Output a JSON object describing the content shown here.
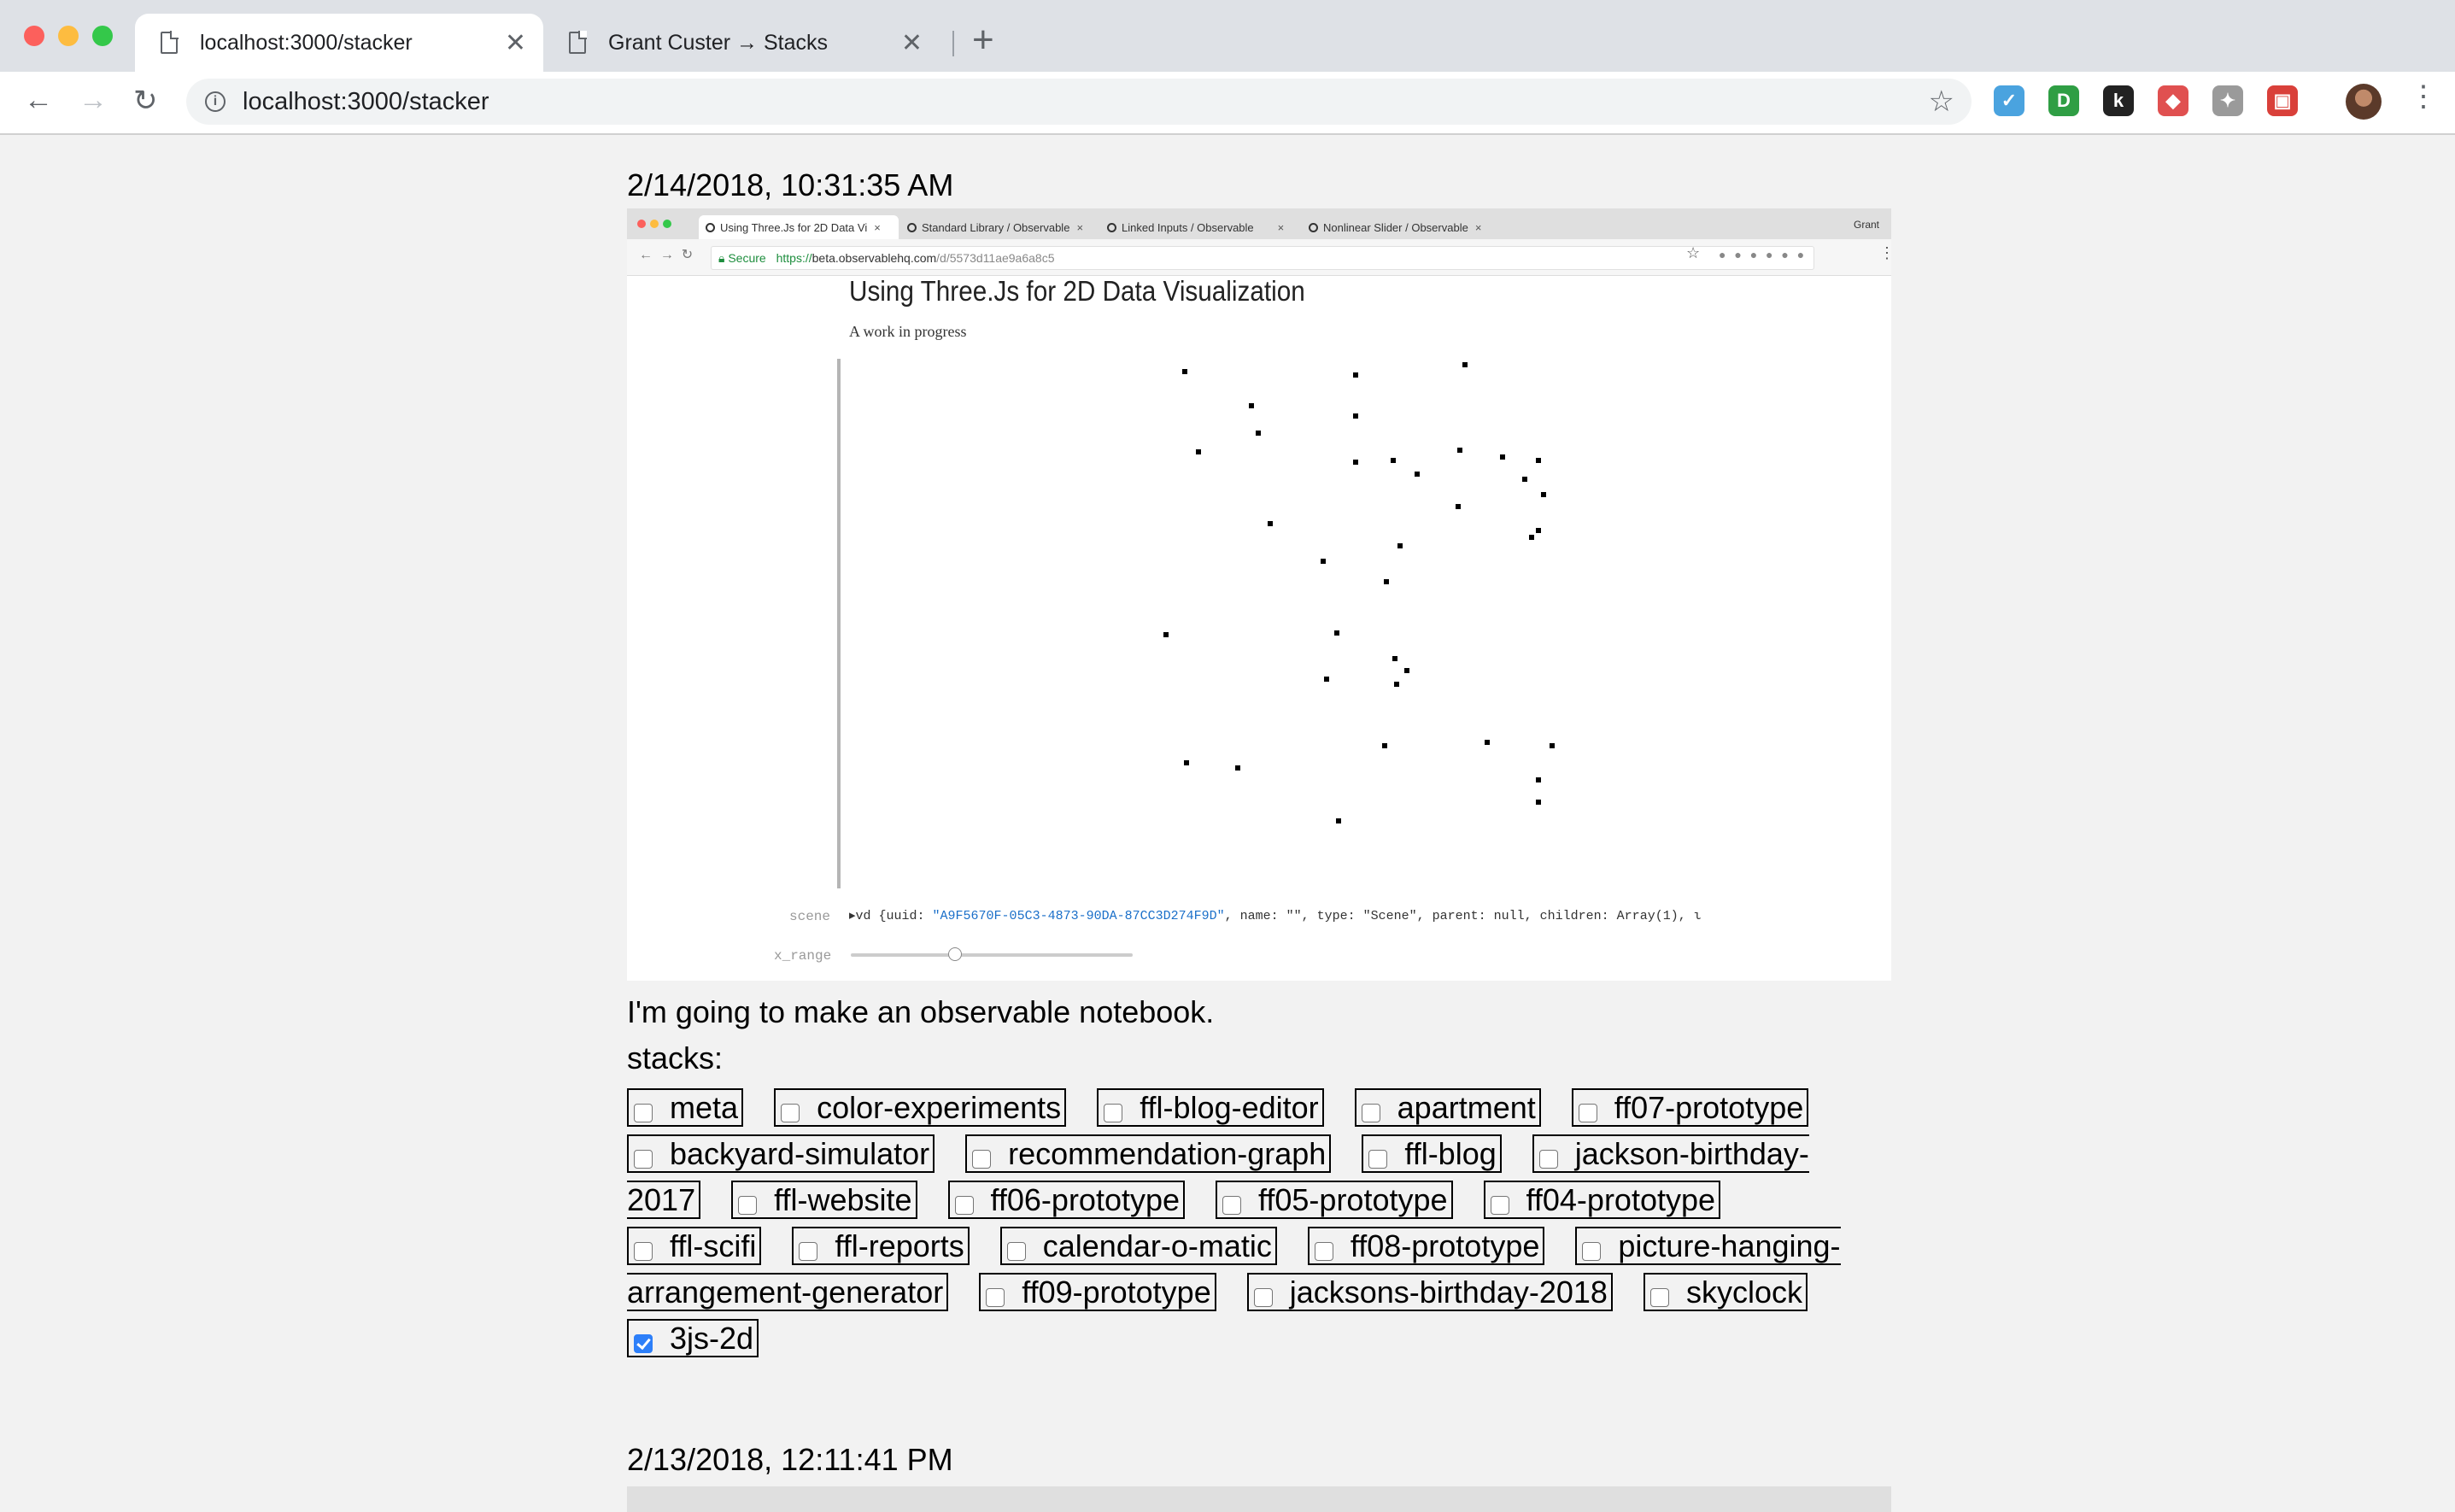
{
  "browser": {
    "tabs": [
      {
        "title": "localhost:3000/stacker",
        "close": "✕"
      },
      {
        "title": "Grant Custer → Stacks",
        "close": "✕"
      }
    ],
    "new_tab": "+",
    "url": "localhost:3000/stacker",
    "icons": {
      "back": "←",
      "forward": "→",
      "reload": "↻",
      "star": "☆",
      "menu": "⋮",
      "info": "i"
    },
    "extensions": [
      {
        "name": "twitter-extension-icon",
        "color": "#4aa3df",
        "glyph": "✓"
      },
      {
        "name": "ghostery-extension-icon",
        "color": "#2f9e44",
        "glyph": "D"
      },
      {
        "name": "k-extension-icon",
        "color": "#222222",
        "glyph": "k"
      },
      {
        "name": "shield-extension-icon",
        "color": "#e05050",
        "glyph": "◆"
      },
      {
        "name": "pin-extension-icon",
        "color": "#9a9a9a",
        "glyph": "✦"
      },
      {
        "name": "photo-extension-icon",
        "color": "#d9403a",
        "glyph": "▣"
      }
    ]
  },
  "entries": [
    {
      "timestamp": "2/14/2018, 10:31:35 AM",
      "screenshot": {
        "tabs": [
          "Using Three.Js for 2D Data Vi",
          "Standard Library / Observable",
          "Linked Inputs / Observable",
          "Nonlinear Slider / Observable"
        ],
        "user": "Grant",
        "secure_label": "Secure",
        "url_https": "https://",
        "url_host": "beta.observablehq.com",
        "url_path": "/d/5573d11ae9a6a8c5",
        "title": "Using Three.Js for 2D Data Visualization",
        "subtitle": "A work in progress",
        "scene_label": "scene",
        "scene_code_prefix": "▸vd {uuid: ",
        "scene_uuid": "\"A9F5670F-05C3-4873-90DA-87CC3D274F9D\"",
        "scene_code_rest": ", name: \"\", type: \"Scene\", parent: null, children: Array(1), ι",
        "x_range_label": "x_range",
        "x_range_value": 0.37
      },
      "description": "I'm going to make an observable notebook.",
      "stacks_label": "stacks:",
      "stacks": [
        {
          "label": "meta",
          "checked": false
        },
        {
          "label": "color-experiments",
          "checked": false
        },
        {
          "label": "ffl-blog-editor",
          "checked": false
        },
        {
          "label": "apartment",
          "checked": false
        },
        {
          "label": "ff07-prototype",
          "checked": false
        },
        {
          "label": "backyard-simulator",
          "checked": false
        },
        {
          "label": "recommendation-graph",
          "checked": false
        },
        {
          "label": "ffl-blog",
          "checked": false
        },
        {
          "label": "jackson-birthday-2017",
          "checked": false
        },
        {
          "label": "ffl-website",
          "checked": false
        },
        {
          "label": "ff06-prototype",
          "checked": false
        },
        {
          "label": "ff05-prototype",
          "checked": false
        },
        {
          "label": "ff04-prototype",
          "checked": false
        },
        {
          "label": "ffl-scifi",
          "checked": false
        },
        {
          "label": "ffl-reports",
          "checked": false
        },
        {
          "label": "calendar-o-matic",
          "checked": false
        },
        {
          "label": "ff08-prototype",
          "checked": false
        },
        {
          "label": "picture-hanging-arrangement-generator",
          "checked": false
        },
        {
          "label": "ff09-prototype",
          "checked": false
        },
        {
          "label": "jacksons-birthday-2018",
          "checked": false
        },
        {
          "label": "skyclock",
          "checked": false
        },
        {
          "label": "3js-2d",
          "checked": true
        }
      ]
    },
    {
      "timestamp": "2/13/2018, 12:11:41 PM"
    }
  ]
}
